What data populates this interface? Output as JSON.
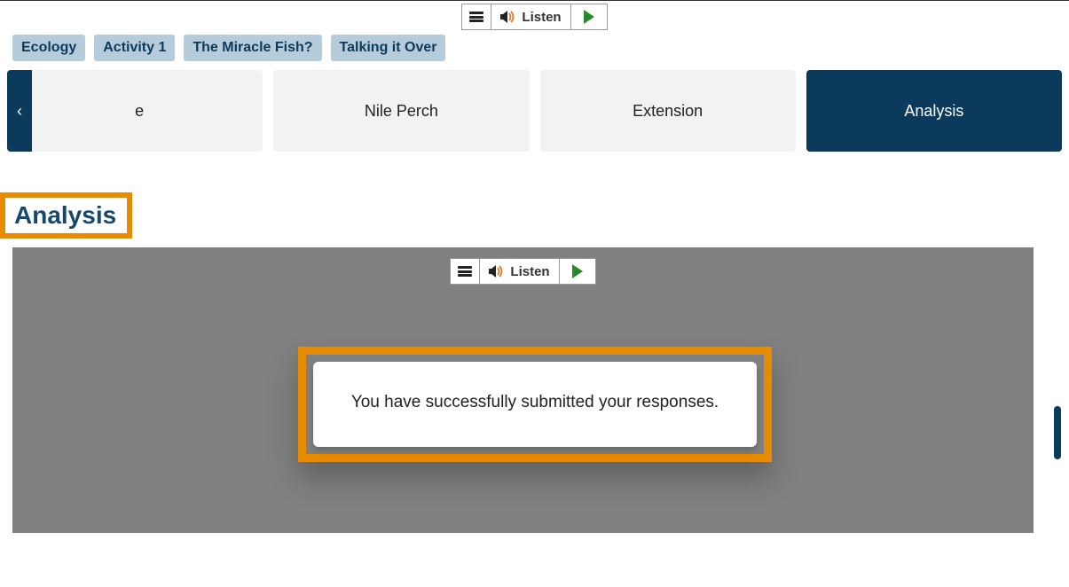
{
  "listen": {
    "label": "Listen"
  },
  "breadcrumbs": [
    {
      "label": "Ecology"
    },
    {
      "label": "Activity 1"
    },
    {
      "label": "The Miracle Fish?"
    },
    {
      "label": "Talking it Over"
    }
  ],
  "tabs": {
    "partial_first": "e",
    "items": [
      {
        "label": "Nile Perch"
      },
      {
        "label": "Extension"
      },
      {
        "label": "Analysis",
        "active": true
      }
    ]
  },
  "page_heading": "Analysis",
  "modal": {
    "message": "You have successfully submitted your responses."
  }
}
